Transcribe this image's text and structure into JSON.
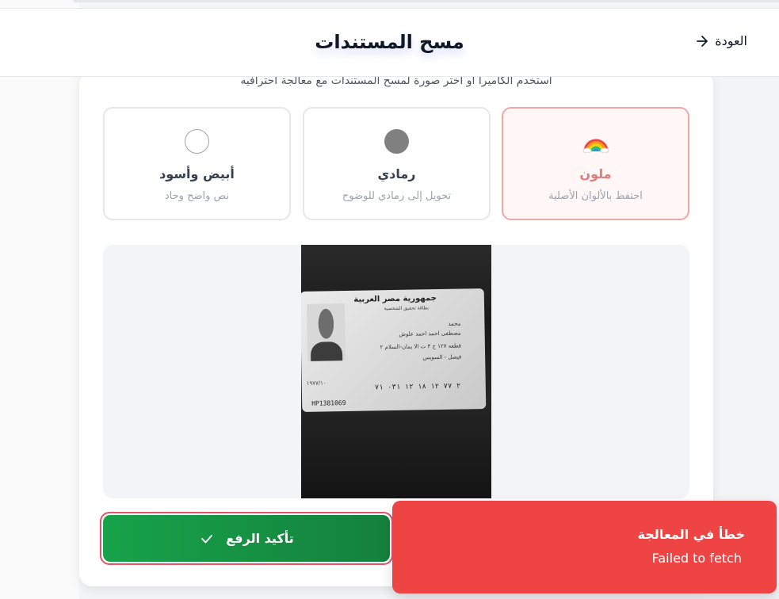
{
  "header": {
    "title": "مسح المستندات",
    "back_label": "العودة"
  },
  "subtitle": "استخدم الكاميرا او اختر صورة لمسح المستندات مع معالجة احترافيه",
  "modes": [
    {
      "icon": "rainbow-icon",
      "label": "ملون",
      "description": "احتفظ بالألوان الأصلية",
      "selected": true
    },
    {
      "icon": "gray-circle-icon",
      "label": "رمادي",
      "description": "تحويل إلى رمادي للوضوح",
      "selected": false
    },
    {
      "icon": "white-circle-icon",
      "label": "أبيض وأسود",
      "description": "نص واضح وحاد",
      "selected": false
    }
  ],
  "preview": {
    "card_header": "جمهورية مصر العربية",
    "card_subheader": "بطاقة تحقيق الشخصية",
    "first_name": "محمد",
    "full_name": "مصطفى احمد احمد علوش",
    "address_line1": "قطعه ١٢٧ ح ٣ ت الا يمان-السلام ٢",
    "address_line2": "فيصل - السويس",
    "national_id": "٢ ٧٧ ١٢ ١٨ ١٢ ٠٣١ ٧١",
    "left_number": "١٩٧٧/١٠",
    "serial": "HP1381069"
  },
  "confirm_button": {
    "label": "تأكيد الرفع",
    "accent": "#17a34a"
  },
  "toast": {
    "title": "خطأ في المعالجة",
    "message": "Failed to fetch",
    "color": "#ef4444"
  }
}
